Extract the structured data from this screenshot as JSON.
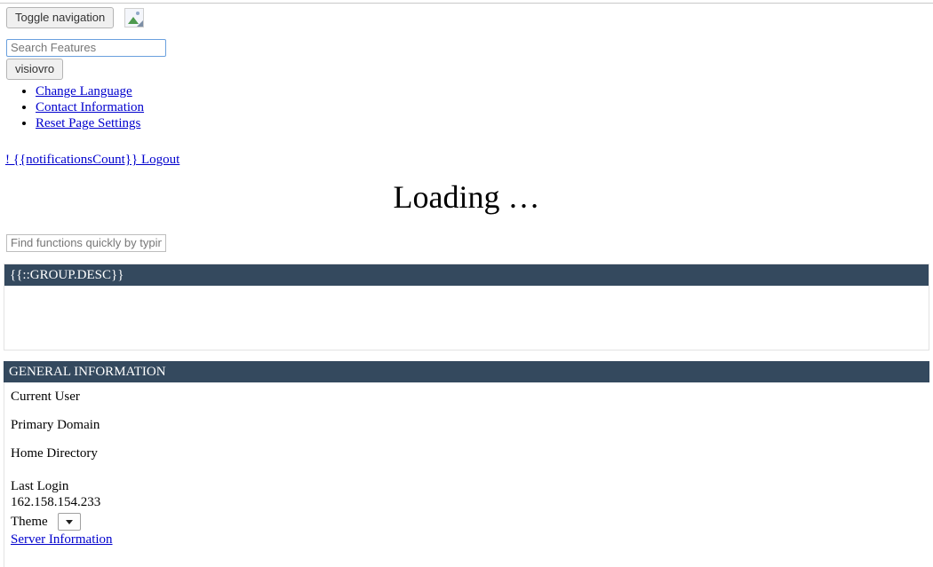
{
  "navbar": {
    "toggle_label": "Toggle navigation",
    "brand_icon": "broken-image-icon",
    "search_placeholder": "Search Features",
    "search_value": "",
    "user_button_label": "visiovro",
    "menu_items": [
      {
        "label": "Change Language"
      },
      {
        "label": "Contact Information"
      },
      {
        "label": "Reset Page Settings"
      }
    ],
    "notifications_label": "! {{notificationsCount}} Logout"
  },
  "main": {
    "loading_text": "Loading …",
    "quickfind_placeholder": "Find functions quickly by typing here",
    "group_panel": {
      "heading": "{{::GROUP.DESC}}",
      "body": ""
    },
    "general_panel": {
      "heading": "GENERAL INFORMATION",
      "rows": [
        {
          "label": "Current User",
          "value": ""
        },
        {
          "label": "Primary Domain",
          "value": ""
        },
        {
          "label": "Home Directory",
          "value": ""
        },
        {
          "label": "Last Login",
          "value": "162.158.154.233"
        }
      ],
      "theme_label": "Theme",
      "theme_selected": "",
      "server_information_label": "Server Information"
    }
  },
  "colors": {
    "panel_heading_bg": "#34495e",
    "link": "#0000cd",
    "panel_border": "#e3e3e3",
    "button_bg": "#f0f0f0"
  }
}
